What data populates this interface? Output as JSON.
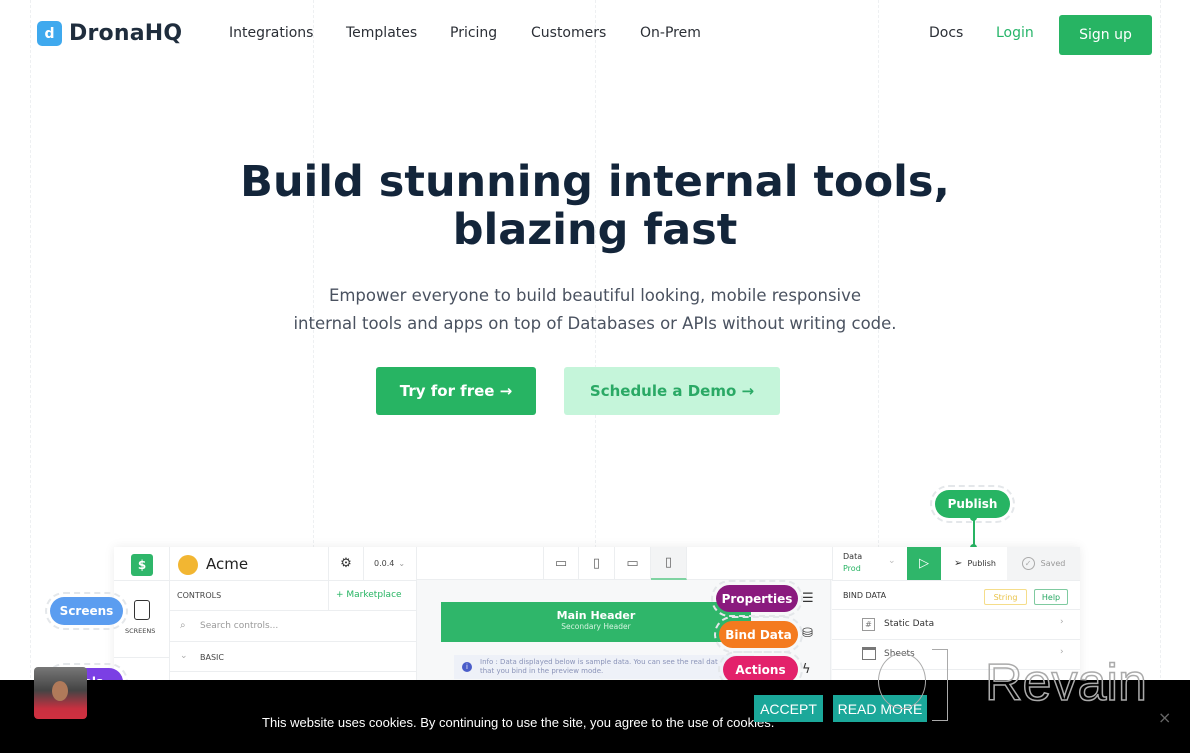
{
  "nav": {
    "brand": "DronaHQ",
    "links": [
      "Integrations",
      "Templates",
      "Pricing",
      "Customers",
      "On-Prem"
    ],
    "docs": "Docs",
    "login": "Login",
    "signup": "Sign up"
  },
  "hero": {
    "title_line1": "Build stunning internal tools,",
    "title_line2": "blazing fast",
    "subtitle_line1": "Empower everyone to build beautiful looking, mobile responsive",
    "subtitle_line2": "internal tools and apps on top of Databases or APIs without writing code.",
    "cta_primary": "Try for free →",
    "cta_secondary": "Schedule a Demo →"
  },
  "callouts": {
    "publish": "Publish",
    "screens": "Screens",
    "controls_partial": "...ols",
    "properties": "Properties",
    "bind_data": "Bind Data",
    "actions": "Actions"
  },
  "editor": {
    "app_name": "Acme",
    "version": "0.0.4",
    "controls_label": "CONTROLS",
    "marketplace": "+ Marketplace",
    "search_placeholder": "Search controls...",
    "basic_section": "BASIC",
    "screens_label": "SCREENS",
    "data_env_label": "Data",
    "data_env_value": "Prod",
    "publish_label": "Publish",
    "saved_label": "Saved",
    "canvas_main_header": "Main Header",
    "canvas_secondary_header": "Secondary Header",
    "info_text_line1": "Info : Data displayed below is sample data. You can see the real dat",
    "info_text_line2": "that you bind in the preview mode.",
    "bind_panel_title": "BIND DATA",
    "tag_string": "String",
    "tag_help": "Help",
    "bind_items": [
      "Static Data",
      "Sheets"
    ]
  },
  "cookie": {
    "message": "This website uses cookies. By continuing to use the site, you agree to the use of cookies.",
    "accept": "ACCEPT",
    "read_more": "READ MORE",
    "close": "×"
  },
  "watermark": {
    "text": "Revain"
  },
  "colors": {
    "brand_green": "#27b463",
    "light_green": "#c5f5da",
    "properties": "#8a1a7e",
    "bind_data": "#f47a1f",
    "actions": "#e3216b",
    "screens": "#5b9df0",
    "controls": "#7b3fe4",
    "cookie_button": "#1ba89a"
  }
}
